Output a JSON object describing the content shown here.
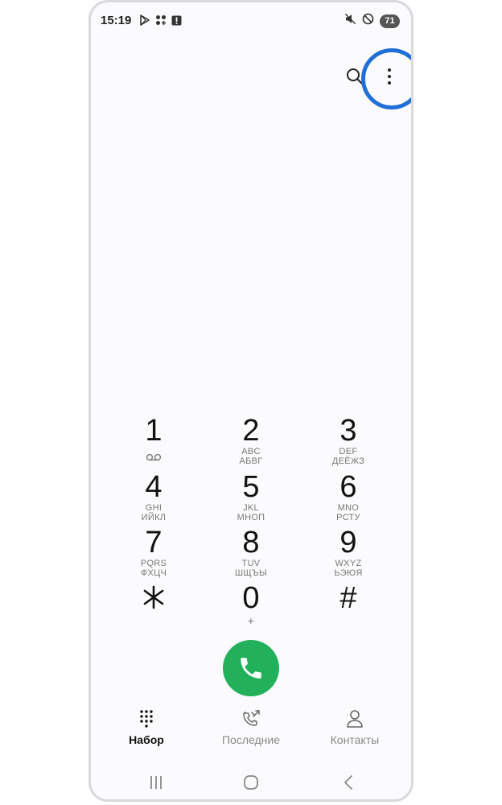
{
  "status_bar": {
    "time": "15:19",
    "battery": "71",
    "left_icons": [
      "play-store-icon",
      "apps-icon",
      "alert-icon"
    ],
    "right_icons": [
      "mute-icon",
      "do-not-disturb-icon",
      "battery-icon"
    ]
  },
  "toolbar": {
    "icons": [
      "search-icon",
      "more-options-icon"
    ],
    "highlight_color": "#1f6fd6"
  },
  "keypad": {
    "keys": [
      {
        "digit": "1",
        "latin": "",
        "cyrillic": "",
        "icon": "voicemail-icon"
      },
      {
        "digit": "2",
        "latin": "ABC",
        "cyrillic": "АБВГ"
      },
      {
        "digit": "3",
        "latin": "DEF",
        "cyrillic": "ДЕЁЖЗ"
      },
      {
        "digit": "4",
        "latin": "GHI",
        "cyrillic": "ИЙКЛ"
      },
      {
        "digit": "5",
        "latin": "JKL",
        "cyrillic": "МНОП"
      },
      {
        "digit": "6",
        "latin": "MNO",
        "cyrillic": "РСТУ"
      },
      {
        "digit": "7",
        "latin": "PQRS",
        "cyrillic": "ФХЦЧ"
      },
      {
        "digit": "8",
        "latin": "TUV",
        "cyrillic": "ШЩЪЫ"
      },
      {
        "digit": "9",
        "latin": "WXYZ",
        "cyrillic": "ЬЭЮЯ"
      },
      {
        "digit": "⁎",
        "latin": "",
        "cyrillic": ""
      },
      {
        "digit": "0",
        "latin": "+",
        "cyrillic": ""
      },
      {
        "digit": "#",
        "latin": "",
        "cyrillic": ""
      }
    ],
    "call_color": "#22b05b"
  },
  "tabs": [
    {
      "label": "Набор",
      "active": true,
      "icon": "dialpad-icon"
    },
    {
      "label": "Последние",
      "active": false,
      "icon": "recent-calls-icon"
    },
    {
      "label": "Контакты",
      "active": false,
      "icon": "contacts-icon"
    }
  ],
  "navbar": {
    "icons": [
      "recent-apps-icon",
      "home-icon",
      "back-icon"
    ]
  }
}
